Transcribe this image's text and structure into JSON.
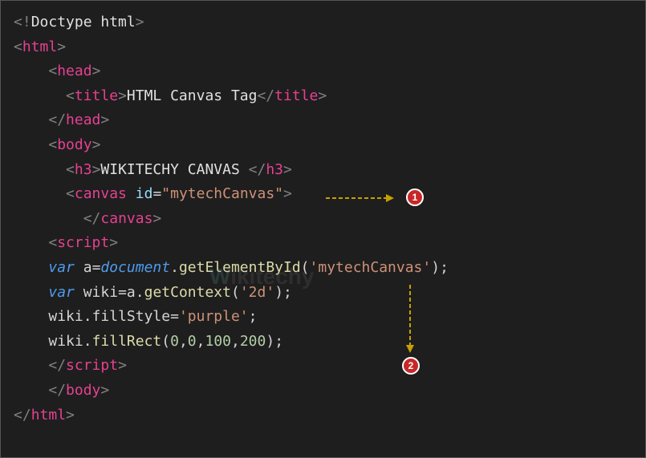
{
  "code": {
    "l1_doctype": "<!Doctype html>",
    "l2_open": "html",
    "l3_open": "head",
    "l4_open": "title",
    "l4_text": "HTML Canvas Tag",
    "l4_close": "title",
    "l5_close": "head",
    "l6_open": "body",
    "l7_open": "h3",
    "l7_text": "WIKITECHY CANVAS ",
    "l7_close": "h3",
    "l8_open": "canvas",
    "l8_attr": "id",
    "l8_val": "\"mytechCanvas\"",
    "l9_close": "canvas",
    "l10_open": "script",
    "l11_kw": "var",
    "l11_var": "a",
    "l11_obj": "document",
    "l11_fn": "getElementById",
    "l11_arg": "'mytechCanvas'",
    "l12_kw": "var",
    "l12_var": "wiki",
    "l12_obj": "a",
    "l12_fn": "getContext",
    "l12_arg": "'2d'",
    "l13_obj": "wiki",
    "l13_prop": "fillStyle",
    "l13_val": "'purple'",
    "l14_obj": "wiki",
    "l14_fn": "fillRect",
    "l14_n1": "0",
    "l14_n2": "0",
    "l14_n3": "100",
    "l14_n4": "200",
    "l15_close": "script",
    "l16_close": "body",
    "l17_close": "html"
  },
  "annotations": {
    "badge1": "1",
    "badge2": "2"
  },
  "watermark": {
    "part1": "W",
    "part2": "ikitechy"
  }
}
